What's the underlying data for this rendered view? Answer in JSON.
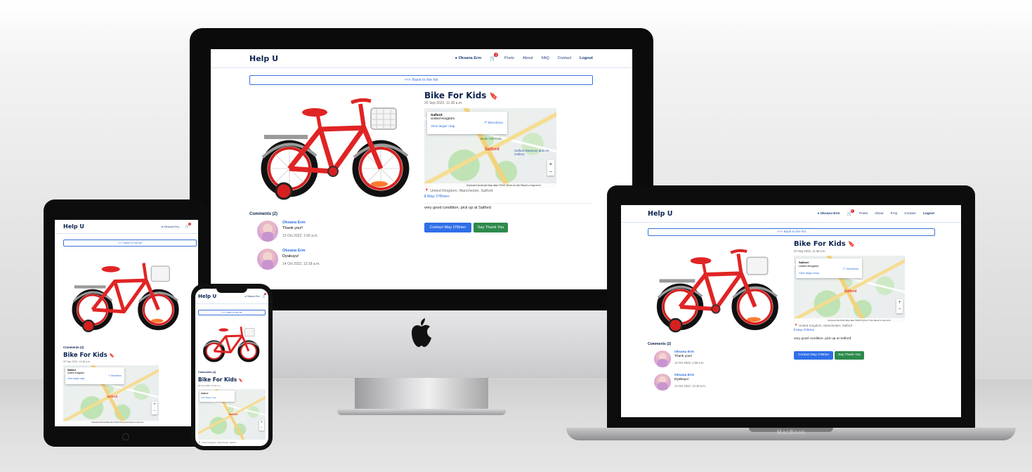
{
  "brand": "Help U",
  "nav": {
    "user": "Oksana Erm",
    "user_short": "Oksana Erq...",
    "cart_count": "4",
    "posts": "Posts",
    "about": "About",
    "faq": "FAQ",
    "contact": "Contact",
    "logout": "Logout"
  },
  "back_label": "<<< Back to the list",
  "post": {
    "title": "Bike For Kids",
    "date": "20 Sep 2022, 11:36 a.m.",
    "location": "United Kingdom, Manchester, Salford",
    "author": "May O'Brien",
    "description": "very good condition. pick up at Salford",
    "contact_btn": "Contact May O'Brien",
    "thank_btn": "Say Thank You"
  },
  "map": {
    "place": "Salford",
    "country": "United Kingdom",
    "directions": "Directions",
    "view_larger": "View larger map",
    "label_salford": "Salford",
    "label_buile_hill": "Buile Hill Park",
    "label_museum": "Salford Museum and Art Gallery",
    "label_lads": "Salford Lads Cl",
    "footer": "Keyboard shortcuts  Map data ©2023  Terms of Use  Report a map error",
    "zoom_in": "+",
    "zoom_out": "−"
  },
  "comments": {
    "heading": "Comments (2)",
    "items": [
      {
        "name": "Oksana Erm",
        "text": "Thank you!!",
        "date": "13 Oct 2022, 1:56 a.m."
      },
      {
        "name": "Oksana Erm",
        "text": "Dyakuyu!",
        "date": "14 Oct 2022, 12:18 a.m."
      }
    ]
  },
  "laptop_label": "MacBook"
}
